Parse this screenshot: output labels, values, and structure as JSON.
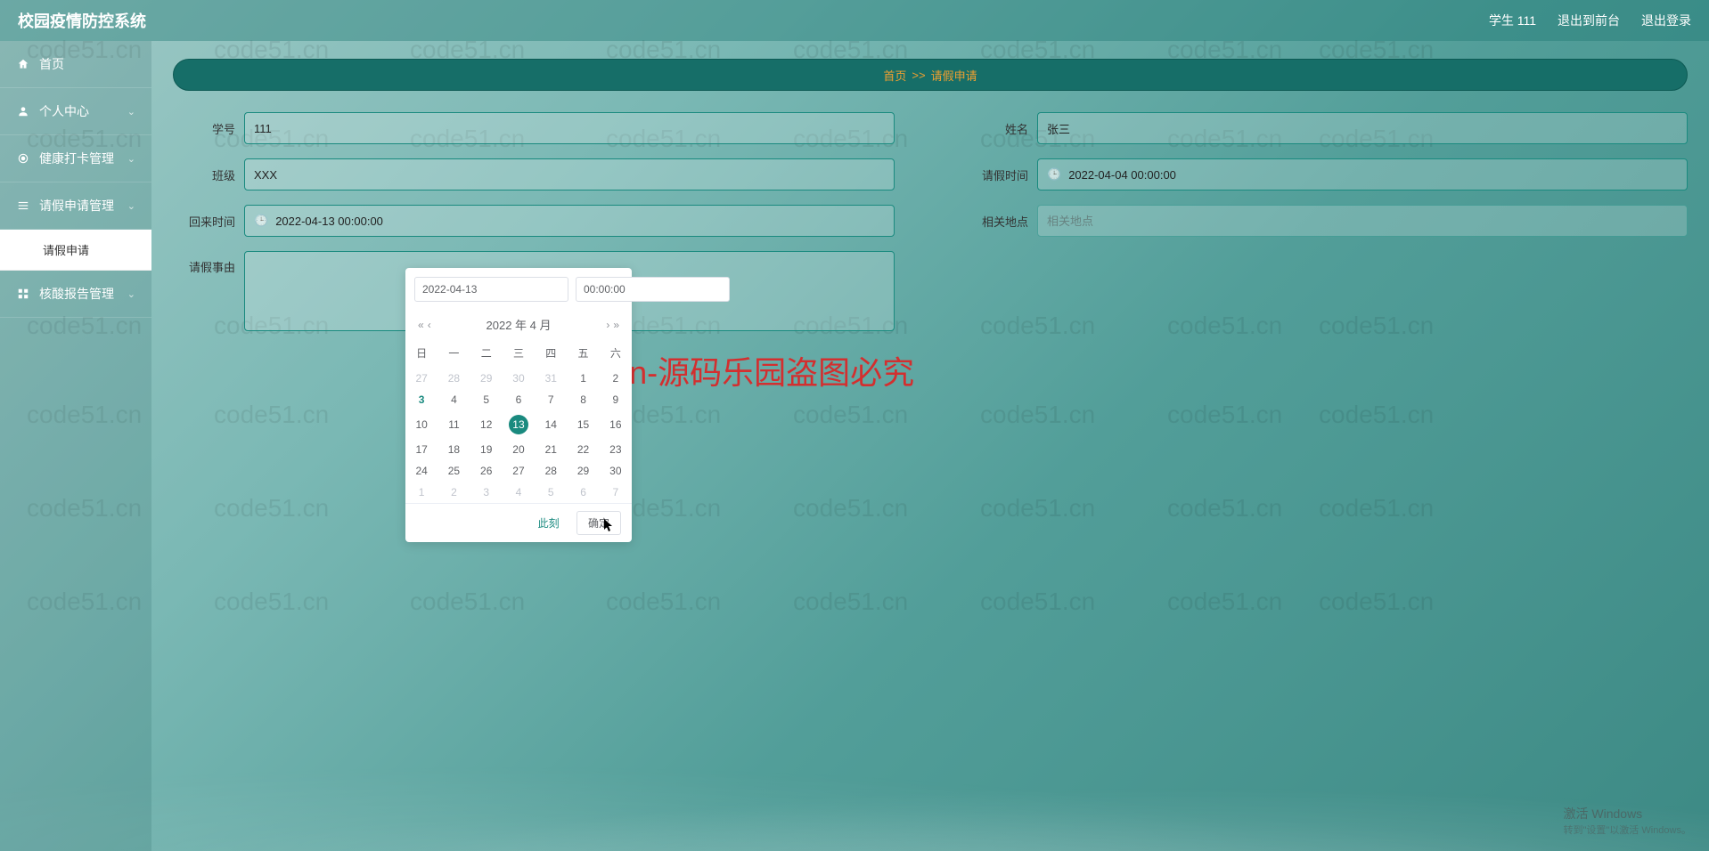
{
  "header": {
    "title": "校园疫情防控系统",
    "user_label": "学生 111",
    "back_front_label": "退出到前台",
    "logout_label": "退出登录"
  },
  "sidebar": {
    "items": [
      {
        "icon": "home",
        "label": "首页",
        "expandable": false
      },
      {
        "icon": "user",
        "label": "个人中心",
        "expandable": true
      },
      {
        "icon": "target",
        "label": "健康打卡管理",
        "expandable": true
      },
      {
        "icon": "list",
        "label": "请假申请管理",
        "expandable": true,
        "open": true,
        "children": [
          {
            "label": "请假申请"
          }
        ]
      },
      {
        "icon": "grid",
        "label": "核酸报告管理",
        "expandable": true
      }
    ]
  },
  "breadcrumb": {
    "home": "首页",
    "sep": ">>",
    "current": "请假申请"
  },
  "form": {
    "student_id": {
      "label": "学号",
      "value": "111"
    },
    "name": {
      "label": "姓名",
      "value": "张三"
    },
    "class": {
      "label": "班级",
      "value": "XXX"
    },
    "leave_time": {
      "label": "请假时间",
      "value": "2022-04-04 00:00:00"
    },
    "return_time": {
      "label": "回来时间",
      "value": "2022-04-13 00:00:00"
    },
    "location": {
      "label": "相关地点",
      "placeholder": "相关地点",
      "value": ""
    },
    "reason": {
      "label": "请假事由",
      "value": ""
    }
  },
  "datepicker": {
    "date_input": "2022-04-13",
    "time_input": "00:00:00",
    "title": "2022 年  4 月",
    "weekdays": [
      "日",
      "一",
      "二",
      "三",
      "四",
      "五",
      "六"
    ],
    "today": 3,
    "selected": 13,
    "grid": [
      [
        {
          "d": 27,
          "o": true
        },
        {
          "d": 28,
          "o": true
        },
        {
          "d": 29,
          "o": true
        },
        {
          "d": 30,
          "o": true
        },
        {
          "d": 31,
          "o": true
        },
        {
          "d": 1
        },
        {
          "d": 2
        }
      ],
      [
        {
          "d": 3
        },
        {
          "d": 4
        },
        {
          "d": 5
        },
        {
          "d": 6
        },
        {
          "d": 7
        },
        {
          "d": 8
        },
        {
          "d": 9
        }
      ],
      [
        {
          "d": 10
        },
        {
          "d": 11
        },
        {
          "d": 12
        },
        {
          "d": 13
        },
        {
          "d": 14
        },
        {
          "d": 15
        },
        {
          "d": 16
        }
      ],
      [
        {
          "d": 17
        },
        {
          "d": 18
        },
        {
          "d": 19
        },
        {
          "d": 20
        },
        {
          "d": 21
        },
        {
          "d": 22
        },
        {
          "d": 23
        }
      ],
      [
        {
          "d": 24
        },
        {
          "d": 25
        },
        {
          "d": 26
        },
        {
          "d": 27
        },
        {
          "d": 28
        },
        {
          "d": 29
        },
        {
          "d": 30
        }
      ],
      [
        {
          "d": 1,
          "o": true
        },
        {
          "d": 2,
          "o": true
        },
        {
          "d": 3,
          "o": true
        },
        {
          "d": 4,
          "o": true
        },
        {
          "d": 5,
          "o": true
        },
        {
          "d": 6,
          "o": true
        },
        {
          "d": 7,
          "o": true
        }
      ]
    ],
    "now_label": "此刻",
    "confirm_label": "确定"
  },
  "watermark_text": "code51.cn",
  "watermark_big": "code51.cn-源码乐园盗图必究",
  "activation": {
    "line1": "激活 Windows",
    "line2": "转到\"设置\"以激活 Windows。"
  }
}
